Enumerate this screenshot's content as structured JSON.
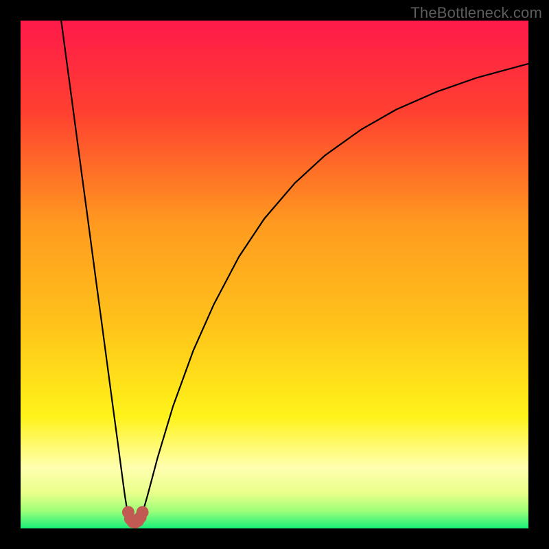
{
  "watermark": "TheBottleneck.com",
  "colors": {
    "frame": "#000000",
    "gradient_top": "#ff1a4a",
    "gradient_mid_upper": "#ff6a2a",
    "gradient_mid": "#ffc31a",
    "gradient_mid_lower": "#ffe81a",
    "gradient_pale": "#ffffb0",
    "gradient_bottom": "#19ef7a",
    "curve": "#000000",
    "marker_fill": "#c15a52",
    "marker_stroke": "#000000"
  },
  "chart_data": {
    "type": "line",
    "title": "",
    "xlabel": "",
    "ylabel": "",
    "xlim": [
      0,
      100
    ],
    "ylim": [
      0,
      100
    ],
    "series": [
      {
        "name": "left-branch",
        "x": [
          8.0,
          9.0,
          10.0,
          11.0,
          12.0,
          13.0,
          14.0,
          15.0,
          16.0,
          17.0,
          18.0,
          19.0,
          20.0,
          20.5,
          21.0,
          21.4
        ],
        "y": [
          100.0,
          92.5,
          85.1,
          77.6,
          70.1,
          62.7,
          55.2,
          47.7,
          40.3,
          32.8,
          25.3,
          17.9,
          10.4,
          6.7,
          3.5,
          2.0
        ]
      },
      {
        "name": "valley-floor",
        "x": [
          21.4,
          21.8,
          22.2,
          22.6,
          23.0,
          23.5,
          24.0
        ],
        "y": [
          2.0,
          1.4,
          1.2,
          1.2,
          1.4,
          2.0,
          3.0
        ]
      },
      {
        "name": "right-branch",
        "x": [
          24.0,
          25.0,
          27.0,
          30.0,
          34.0,
          38.0,
          43.0,
          48.0,
          54.0,
          60.0,
          67.0,
          74.0,
          82.0,
          90.0,
          100.0
        ],
        "y": [
          3.0,
          6.5,
          14.0,
          24.0,
          35.0,
          44.0,
          53.5,
          61.0,
          68.0,
          73.5,
          78.5,
          82.5,
          86.0,
          88.8,
          91.5
        ]
      }
    ],
    "markers": [
      {
        "x": 21.2,
        "y": 3.2
      },
      {
        "x": 21.6,
        "y": 1.9
      },
      {
        "x": 22.1,
        "y": 1.3
      },
      {
        "x": 22.6,
        "y": 1.2
      },
      {
        "x": 23.1,
        "y": 1.5
      },
      {
        "x": 23.6,
        "y": 2.2
      },
      {
        "x": 24.0,
        "y": 3.2
      }
    ]
  }
}
